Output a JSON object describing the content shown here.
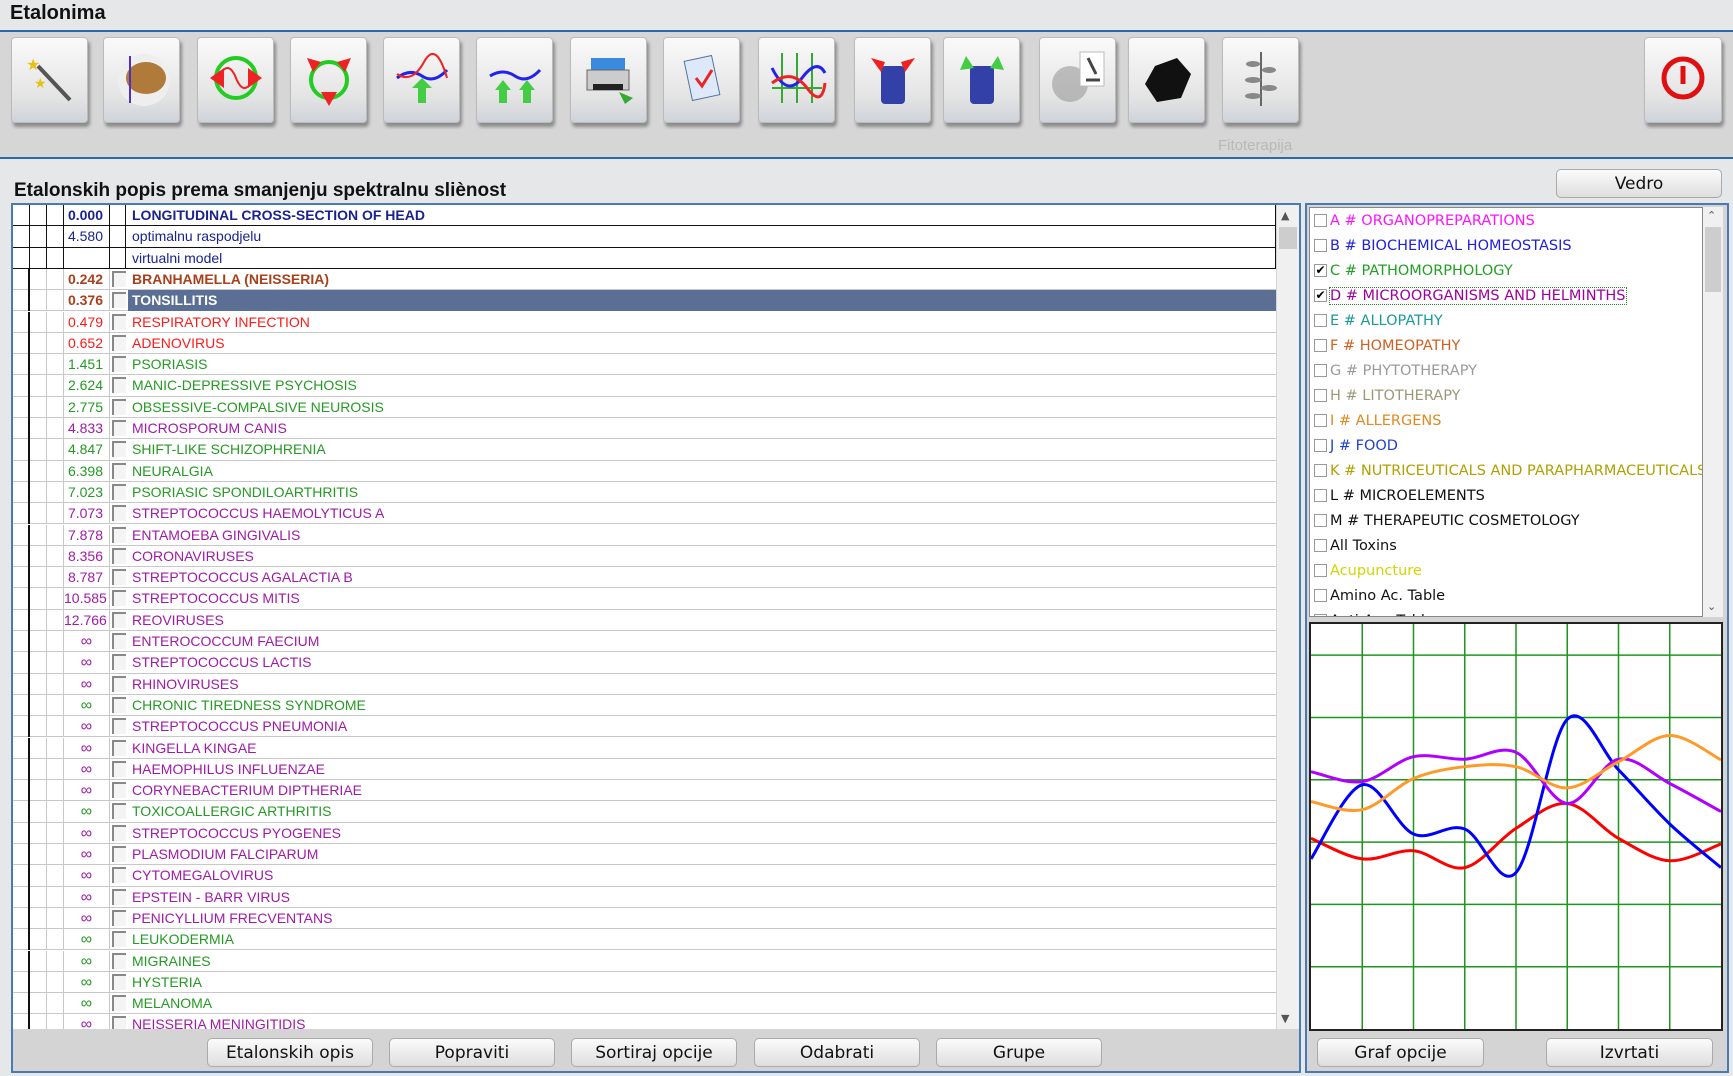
{
  "window": {
    "title": "Etalonima"
  },
  "toolbar": {
    "buttons": [
      {
        "icon": "magic-wand-icon"
      },
      {
        "icon": "brain-scan-icon"
      },
      {
        "icon": "circle-arrows-icon"
      },
      {
        "icon": "triple-arrows-icon"
      },
      {
        "icon": "graph-up-arrow-icon"
      },
      {
        "icon": "graph-double-up-arrow-icon"
      },
      {
        "icon": "printer-icon"
      },
      {
        "icon": "clipboard-check-icon"
      },
      {
        "icon": "spectrum-graph-icon"
      },
      {
        "icon": "beaker-red-arrows-icon"
      },
      {
        "icon": "beaker-green-arrows-icon"
      },
      {
        "icon": "microscope-icon"
      },
      {
        "icon": "black-stone-icon"
      },
      {
        "icon": "herb-plant-icon"
      }
    ],
    "hover_label": "Fitoterapija",
    "power_icon": "power-icon"
  },
  "section_title": "Etalonskih popis prema smanjenju spektralnu sliènost",
  "vedro_button": "Vedro",
  "colors": {
    "navy": "#1a2290",
    "brown": "#a8401c",
    "red": "#ff1a1a",
    "green": "#249a24",
    "purple": "#a01aa8",
    "selected": "#5b6f95"
  },
  "etalon_list": [
    {
      "value": "0.000",
      "name": "LONGITUDINAL CROSS-SECTION OF HEAD",
      "color": "navy",
      "bold": true,
      "top": true
    },
    {
      "value": "4.580",
      "name": "optimalnu raspodjelu",
      "color": "navy",
      "top": true
    },
    {
      "value": "",
      "name": "virtualni model",
      "color": "navy",
      "top": true
    },
    {
      "value": "0.242",
      "name": "BRANHAMELLA (NEISSERIA)",
      "color": "brown",
      "bold": true
    },
    {
      "value": "0.376",
      "name": "TONSILLITIS",
      "color": "brown",
      "bold": true,
      "selected": true
    },
    {
      "value": "0.479",
      "name": "RESPIRATORY  INFECTION",
      "color": "red"
    },
    {
      "value": "0.652",
      "name": "ADENOVIRUS",
      "color": "red"
    },
    {
      "value": "1.451",
      "name": "PSORIASIS",
      "color": "green"
    },
    {
      "value": "2.624",
      "name": "MANIC-DEPRESSIVE  PSYCHOSIS",
      "color": "green"
    },
    {
      "value": "2.775",
      "name": "OBSESSIVE-COMPALSIVE NEUROSIS",
      "color": "green"
    },
    {
      "value": "4.833",
      "name": "MICROSPORUM  CANIS",
      "color": "purple"
    },
    {
      "value": "4.847",
      "name": "SHIFT-LIKE  SCHIZOPHRENIA",
      "color": "green"
    },
    {
      "value": "6.398",
      "name": "NEURALGIA",
      "color": "green"
    },
    {
      "value": "7.023",
      "name": "PSORIASIC  SPONDILOARTHRITIS",
      "color": "green"
    },
    {
      "value": "7.073",
      "name": "STREPTOCOCCUS  HAEMOLYTICUS  A",
      "color": "purple"
    },
    {
      "value": "7.878",
      "name": "ENTAMOEBA GINGIVALIS",
      "color": "purple"
    },
    {
      "value": "8.356",
      "name": "CORONAVIRUSES",
      "color": "purple"
    },
    {
      "value": "8.787",
      "name": "STREPTOCOCCUS  AGALACTIA  B",
      "color": "purple"
    },
    {
      "value": "10.585",
      "name": "STREPTOCOCCUS MITIS",
      "color": "purple"
    },
    {
      "value": "12.766",
      "name": "REOVIRUSES",
      "color": "purple"
    },
    {
      "value": "∞",
      "name": "ENTEROCOCCUM  FAECIUM",
      "color": "purple"
    },
    {
      "value": "∞",
      "name": "STREPTOCOCCUS LACTIS",
      "color": "purple"
    },
    {
      "value": "∞",
      "name": "RHINOVIRUSES",
      "color": "purple"
    },
    {
      "value": "∞",
      "name": "CHRONIC TIREDNESS SYNDROME",
      "color": "green"
    },
    {
      "value": "∞",
      "name": "STREPTOCOCCUS  PNEUMONIA",
      "color": "purple"
    },
    {
      "value": "∞",
      "name": "KINGELLA  KINGAE",
      "color": "purple"
    },
    {
      "value": "∞",
      "name": "HAEMOPHILUS INFLUENZAE",
      "color": "purple"
    },
    {
      "value": "∞",
      "name": "CORYNEBACTERIUM  DIPTHERIAE",
      "color": "purple"
    },
    {
      "value": "∞",
      "name": "TOXICOALLERGIC  ARTHRITIS",
      "color": "green"
    },
    {
      "value": "∞",
      "name": "STREPTOCOCCUS PYOGENES",
      "color": "purple"
    },
    {
      "value": "∞",
      "name": "PLASMODIUM FALCIPARUM",
      "color": "purple"
    },
    {
      "value": "∞",
      "name": "CYTOMEGALOVIRUS",
      "color": "purple"
    },
    {
      "value": "∞",
      "name": "EPSTEIN - BARR VIRUS",
      "color": "purple"
    },
    {
      "value": "∞",
      "name": "PENICYLLIUM  FRECVENTANS",
      "color": "purple"
    },
    {
      "value": "∞",
      "name": "LEUKODERMIA",
      "color": "green"
    },
    {
      "value": "∞",
      "name": "MIGRAINES",
      "color": "green"
    },
    {
      "value": "∞",
      "name": "HYSTERIA",
      "color": "green"
    },
    {
      "value": "∞",
      "name": "MELANOMA",
      "color": "green"
    },
    {
      "value": "∞",
      "name": "NEISSERIA  MENINGITIDIS",
      "color": "purple"
    }
  ],
  "bottom_buttons": [
    "Etalonskih opis",
    "Popraviti",
    "Sortiraj opcije",
    "Odabrati",
    "Grupe"
  ],
  "categories": [
    {
      "label": "A # ORGANOPREPARATIONS",
      "color": "#ff10ff",
      "checked": false
    },
    {
      "label": "B # BIOCHEMICAL HOMEOSTASIS",
      "color": "#2020e0",
      "checked": false
    },
    {
      "label": "C # PATHOMORPHOLOGY",
      "color": "#22a022",
      "checked": true
    },
    {
      "label": "D # MICROORGANISMS AND HELMINTHS",
      "color": "#a000a0",
      "checked": true,
      "focused": true
    },
    {
      "label": "E # ALLOPATHY",
      "color": "#1a9a9a",
      "checked": false
    },
    {
      "label": "F # HOMEOPATHY",
      "color": "#d06020",
      "checked": false
    },
    {
      "label": "G # PHYTOTHERAPY",
      "color": "#9a9a9a",
      "checked": false
    },
    {
      "label": "H # LITOTHERAPY",
      "color": "#9a9a78",
      "checked": false
    },
    {
      "label": "I # ALLERGENS",
      "color": "#e08a20",
      "checked": false
    },
    {
      "label": "J # FOOD",
      "color": "#2040d0",
      "checked": false
    },
    {
      "label": "K # NUTRICEUTICALS AND PARAPHARMACEUTICALS",
      "color": "#b0a000",
      "checked": false
    },
    {
      "label": "L # MICROELEMENTS",
      "color": "#111111",
      "checked": false
    },
    {
      "label": "M # THERAPEUTIC COSMETOLOGY",
      "color": "#111111",
      "checked": false
    },
    {
      "label": "All Toxins",
      "color": "#111111",
      "checked": false
    },
    {
      "label": "Acupuncture",
      "color": "#d4d400",
      "checked": false
    },
    {
      "label": "Amino Ac. Table",
      "color": "#111111",
      "checked": false
    },
    {
      "label": "Anti-Age Table",
      "color": "#111111",
      "checked": false
    }
  ],
  "graph_buttons": [
    "Graf opcije",
    "Izvrtati"
  ],
  "chart_data": {
    "type": "line",
    "grid": true,
    "grid_color": "#1e961e",
    "x": [
      0,
      1,
      2,
      3,
      4,
      5,
      6,
      7,
      8
    ],
    "ylim": [
      0,
      6.5
    ],
    "series": [
      {
        "color": "#ff0000",
        "values": [
          3.06,
          2.73,
          2.86,
          2.59,
          3.22,
          3.62,
          3.06,
          2.7,
          2.97
        ]
      },
      {
        "color": "#0000ff",
        "values": [
          2.73,
          3.92,
          3.13,
          3.21,
          2.51,
          4.97,
          4.16,
          3.29,
          2.59
        ]
      },
      {
        "color": "#b000ff",
        "values": [
          4.13,
          3.97,
          4.37,
          4.33,
          4.44,
          3.62,
          4.33,
          3.94,
          3.49
        ]
      },
      {
        "color": "#ff9a2a",
        "values": [
          3.65,
          3.52,
          4.02,
          4.21,
          4.21,
          3.87,
          4.29,
          4.71,
          4.32
        ]
      }
    ]
  }
}
